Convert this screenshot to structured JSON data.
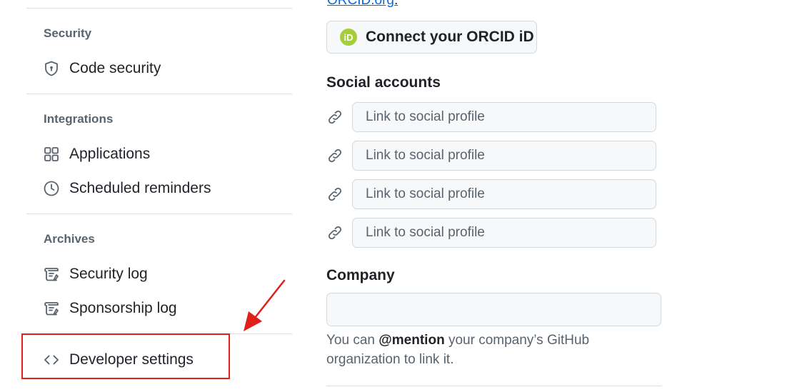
{
  "sidebar": {
    "sections": [
      {
        "heading": "Security",
        "items": [
          {
            "label": "Code security",
            "icon": "shield-lock-icon"
          }
        ]
      },
      {
        "heading": "Integrations",
        "items": [
          {
            "label": "Applications",
            "icon": "apps-icon"
          },
          {
            "label": "Scheduled reminders",
            "icon": "clock-icon"
          }
        ]
      },
      {
        "heading": "Archives",
        "items": [
          {
            "label": "Security log",
            "icon": "log-icon"
          },
          {
            "label": "Sponsorship log",
            "icon": "log-icon"
          }
        ]
      }
    ],
    "developer": {
      "label": "Developer settings",
      "icon": "code-icon"
    }
  },
  "main": {
    "orcid_link": "ORCID.org",
    "orcid_link_suffix": ".",
    "orcid_button": "Connect your ORCID iD",
    "orcid_badge": "iD",
    "social_heading": "Social accounts",
    "social_placeholder": "Link to social profile",
    "company_heading": "Company",
    "company_value": "",
    "help": {
      "prefix": "You can ",
      "mention": "@mention",
      "suffix": " your company’s GitHub organization to link it."
    }
  },
  "colors": {
    "accent_link": "#0969da",
    "orcid_green": "#a6ce39",
    "annotation_red": "#e0201a"
  }
}
